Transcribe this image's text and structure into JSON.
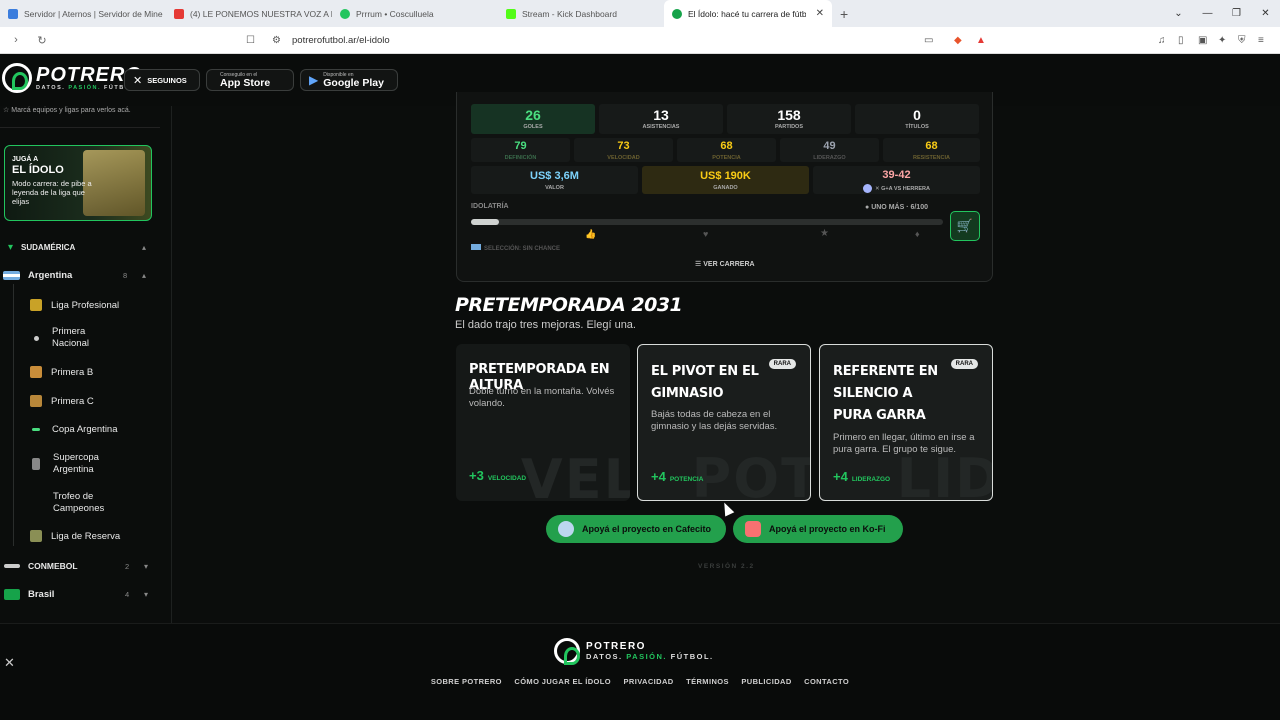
{
  "browser": {
    "tabs": [
      {
        "title": "Servidor | Aternos | Servidor de Mine",
        "color": "#3b7ddd"
      },
      {
        "title": "(4) LE PONEMOS NUESTRA VOZ A PI",
        "color": "#e53935"
      },
      {
        "title": "Prrrum • Cosculluela",
        "color": "#22c55e"
      },
      {
        "title": "Stream - Kick Dashboard",
        "color": "#53fc18"
      },
      {
        "title": "El Ídolo: hacé tu carrera de fútbo",
        "color": "#16a34a"
      }
    ],
    "url": "potrerofutbol.ar/el-idolo"
  },
  "header": {
    "logo_name": "POTRERO",
    "tag_a": "DATOS. ",
    "tag_b": "PASIÓN.",
    "tag_c": " FÚTBOL.",
    "follow_label": "SEGUINOS",
    "appstore_small": "Conseguilo en el",
    "appstore_big": "App Store",
    "play_small": "Disponible en",
    "play_big": "Google Play"
  },
  "sidebar": {
    "note": "Marcá equipos y ligas para verlos acá.",
    "promo": {
      "small": "JUGÁ A",
      "big": "EL ÍDOLO",
      "desc": "Modo carrera: de pibe a leyenda de la liga que elijas"
    },
    "section": "SUDAMÉRICA",
    "country": {
      "name": "Argentina",
      "count": "8"
    },
    "leagues": [
      "Liga Profesional",
      "Primera Nacional",
      "Primera B",
      "Primera C",
      "Copa Argentina",
      "Supercopa Argentina",
      "Trofeo de Campeones",
      "Liga de Reserva"
    ],
    "others": [
      {
        "name": "CONMEBOL",
        "count": "2"
      },
      {
        "name": "Brasil",
        "count": "4"
      }
    ]
  },
  "stats": {
    "row1": [
      {
        "value": "26",
        "label": "GOLES"
      },
      {
        "value": "13",
        "label": "ASISTENCIAS"
      },
      {
        "value": "158",
        "label": "PARTIDOS"
      },
      {
        "value": "0",
        "label": "TÍTULOS"
      }
    ],
    "row2": [
      {
        "value": "79",
        "label": "DEFINICIÓN",
        "color": "#4ade80"
      },
      {
        "value": "73",
        "label": "VELOCIDAD",
        "color": "#facc15"
      },
      {
        "value": "68",
        "label": "POTENCIA",
        "color": "#facc15"
      },
      {
        "value": "49",
        "label": "LIDERAZGO",
        "color": "#9ca3af"
      },
      {
        "value": "68",
        "label": "RESISTENCIA",
        "color": "#facc15"
      }
    ],
    "row3": [
      {
        "value": "US$ 3,6M",
        "label": "VALOR",
        "color": "#60a5fa"
      },
      {
        "value": "US$ 190K",
        "label": "GANADO",
        "color": "#facc15"
      },
      {
        "value": "39-42",
        "label": "G+A VS HERRERA",
        "color": "#fca5a5"
      }
    ],
    "idolatry_label": "IDOLATRÍA",
    "idolatry_progress": 0.06,
    "uno_mas": "UNO MÁS · 6/100",
    "seleccion": "SELECCIÓN: SIN CHANCE",
    "ver_carrera": "VER CARRERA"
  },
  "season": {
    "title": "PRETEMPORADA 2031",
    "subtitle": "El dado trajo tres mejoras. Elegí una.",
    "cards": [
      {
        "title": "PRETEMPORADA EN ALTURA",
        "desc": "Doble turno en la montaña. Volvés volando.",
        "bonus": "+3",
        "stat": "VELOCIDAD",
        "watermark": "VEL",
        "badge": ""
      },
      {
        "title": "EL PIVOT EN EL GIMNASIO",
        "desc": "Bajás todas de cabeza en el gimnasio y las dejás servidas.",
        "bonus": "+4",
        "stat": "POTENCIA",
        "watermark": "POT",
        "badge": "RARA"
      },
      {
        "title": "REFERENTE EN SILENCIO A PURA GARRA",
        "desc": "Primero en llegar, último en irse a pura garra. El grupo te sigue.",
        "bonus": "+4",
        "stat": "LIDERAZGO",
        "watermark": "LID",
        "badge": "RARA"
      }
    ]
  },
  "support": {
    "cafecito": "Apoyá el proyecto en Cafecito",
    "kofi": "Apoyá el proyecto en Ko-Fi"
  },
  "version": "VERSIÓN 2.2",
  "footer": {
    "links": [
      "SOBRE POTRERO",
      "CÓMO JUGAR EL ÍDOLO",
      "PRIVACIDAD",
      "TÉRMINOS",
      "PUBLICIDAD",
      "CONTACTO"
    ]
  }
}
